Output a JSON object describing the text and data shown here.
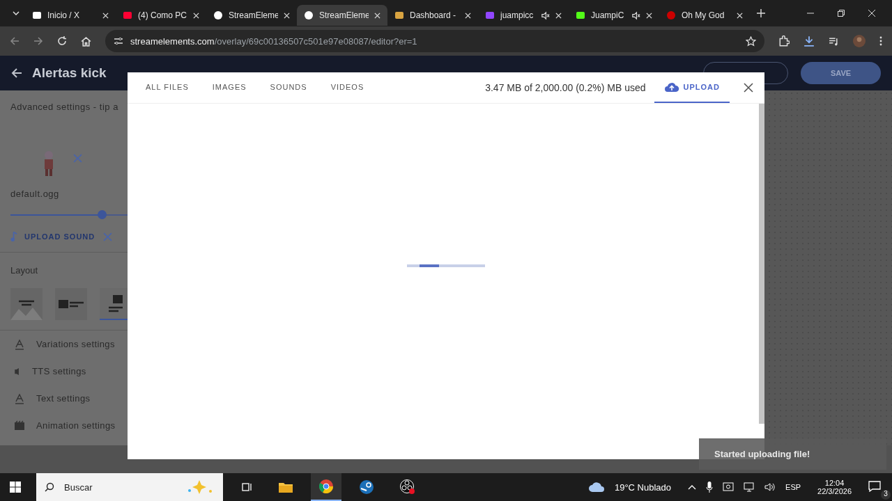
{
  "browser": {
    "tabs": [
      {
        "title": "Inicio / X",
        "kind": "x",
        "muted": false,
        "selected": false
      },
      {
        "title": "(4) Como PC",
        "kind": "youtube",
        "muted": false,
        "selected": false
      },
      {
        "title": "StreamEleme",
        "kind": "se",
        "muted": false,
        "selected": false
      },
      {
        "title": "StreamEleme",
        "kind": "se",
        "muted": false,
        "selected": true
      },
      {
        "title": "Dashboard -",
        "kind": "dash",
        "muted": false,
        "selected": false
      },
      {
        "title": "juampicc",
        "kind": "twitch",
        "muted": true,
        "selected": false
      },
      {
        "title": "JuampiC",
        "kind": "kick",
        "muted": true,
        "selected": false
      },
      {
        "title": "Oh My God",
        "kind": "red",
        "muted": false,
        "selected": false
      }
    ],
    "url_host": "streamelements.com",
    "url_path": "/overlay/69c00136507c501e97e08087/editor?er=1"
  },
  "editor": {
    "title": "Alertas kick",
    "save": "SAVE",
    "section": "Advanced settings - tip a",
    "sound_file": "default.ogg",
    "volume": {
      "level": 0.535
    },
    "upload_sound": "UPLOAD SOUND",
    "layout_label": "Layout",
    "layouts": [
      {
        "kind": "banner",
        "selected": false
      },
      {
        "kind": "side",
        "selected": false
      },
      {
        "kind": "stacked",
        "selected": true
      }
    ],
    "settings": [
      {
        "kind": "text",
        "label": "Variations settings"
      },
      {
        "kind": "speaker",
        "label": "TTS settings"
      },
      {
        "kind": "text",
        "label": "Text settings"
      },
      {
        "kind": "film",
        "label": "Animation settings"
      }
    ]
  },
  "media_dialog": {
    "tabs": [
      {
        "label": "ALL FILES",
        "selected": false
      },
      {
        "label": "IMAGES",
        "selected": false
      },
      {
        "label": "SOUNDS",
        "selected": false
      },
      {
        "label": "VIDEOS",
        "selected": false
      }
    ],
    "storage": "3.47 MB of 2,000.00 (0.2%) MB used",
    "upload": {
      "label": "UPLOAD",
      "selected": true
    },
    "progress": {
      "level": 0.25
    }
  },
  "toast": "Started uploading file!",
  "taskbar": {
    "search": "Buscar",
    "weather": "19°C  Nublado",
    "language": "ESP",
    "time": "12:04",
    "date": "22/3/2026",
    "notifications": "3"
  }
}
